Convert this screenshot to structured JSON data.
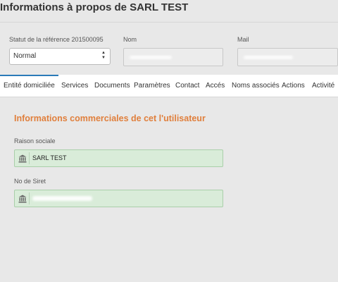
{
  "page": {
    "title": "Informations à propos de SARL TEST"
  },
  "reference": {
    "status_label": "Statut de la référence 201500095",
    "status_value": "Normal",
    "nom_label": "Nom",
    "mail_label": "Mail"
  },
  "tabs": [
    {
      "label": "Entité domiciliée",
      "active": true
    },
    {
      "label": "Services"
    },
    {
      "label": "Documents"
    },
    {
      "label": "Paramètres"
    },
    {
      "label": "Contact"
    },
    {
      "label": "Accés"
    },
    {
      "label": "Noms associés"
    },
    {
      "label": "Actions"
    },
    {
      "label": "Activité"
    }
  ],
  "section": {
    "title": "Informations commerciales de cet l'utilisateur",
    "raison_label": "Raison sociale",
    "raison_value": "SARL TEST",
    "siret_label": "No de Siret"
  },
  "icons": {
    "field_icon": "bank-icon"
  },
  "colors": {
    "accent_orange": "#e07f3c",
    "tab_active_border": "#2a7ab8",
    "field_green": "#d9ecd9"
  }
}
